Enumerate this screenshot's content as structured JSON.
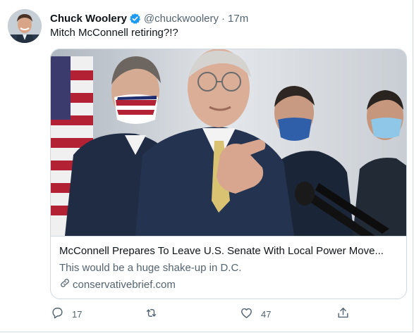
{
  "tweet": {
    "author_name": "Chuck Woolery",
    "author_handle": "@chuckwoolery",
    "separator": "·",
    "timestamp": "17m",
    "text": "Mitch McConnell retiring?!?"
  },
  "card": {
    "title": "McConnell Prepares To Leave U.S. Senate With Local Power Move...",
    "description": "This would be a huge shake-up in D.C.",
    "domain": "conservativebrief.com"
  },
  "actions": {
    "reply_count": "17",
    "retweet_count": "",
    "like_count": "47"
  },
  "colors": {
    "verified_badge": "#1d9bf0",
    "secondary_text": "#536471",
    "border": "#cfd9de"
  },
  "icons": [
    "verified-badge-icon",
    "link-icon",
    "reply-icon",
    "retweet-icon",
    "like-icon",
    "share-icon"
  ]
}
